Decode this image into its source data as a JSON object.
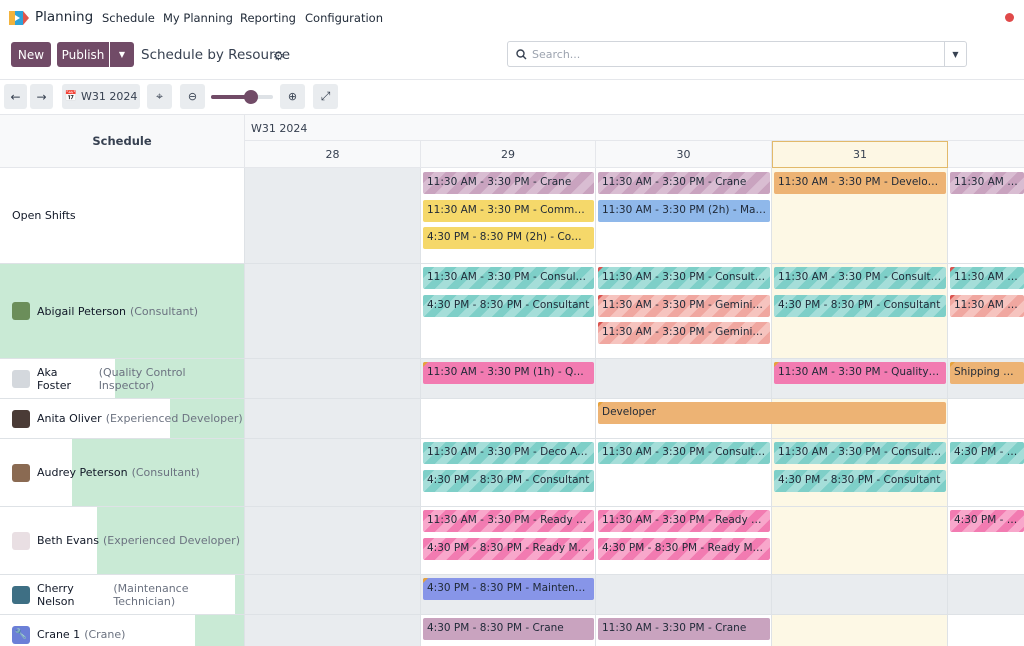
{
  "nav": {
    "app_title": "Planning",
    "menus": [
      "Schedule",
      "My Planning",
      "Reporting",
      "Configuration"
    ]
  },
  "control": {
    "new_label": "New",
    "publish_label": "Publish",
    "page_title": "Schedule by Resource",
    "search_placeholder": "Search..."
  },
  "toolbar": {
    "week_label": "W31 2024",
    "zoom_level": 0.65
  },
  "grid": {
    "left_header": "Schedule",
    "week_header": "W31 2024",
    "days": [
      "28",
      "29",
      "30",
      "31"
    ],
    "rows": [
      {
        "name": "Open Shifts",
        "role": ""
      },
      {
        "name": "Abigail Peterson",
        "role": "(Consultant)"
      },
      {
        "name": "Aka Foster",
        "role": "(Quality Control Inspector)"
      },
      {
        "name": "Anita Oliver",
        "role": "(Experienced Developer)"
      },
      {
        "name": "Audrey Peterson",
        "role": "(Consultant)"
      },
      {
        "name": "Beth Evans",
        "role": "(Experienced Developer)"
      },
      {
        "name": "Cherry Nelson",
        "role": "(Maintenance Technician)"
      },
      {
        "name": "Crane 1",
        "role": "(Crane)"
      }
    ]
  },
  "shifts": [
    "11:30 AM - 3:30 PM - Crane",
    "11:30 AM - 3:30 PM - Crane",
    "11:30 AM - 3:30 PM - Developer ...",
    "11:30 AM - 3:30",
    "11:30 AM - 3:30 PM - Communit...",
    "11:30 AM - 3:30 PM (2h) - Mana...",
    "4:30 PM - 8:30 PM (2h) - Commu...",
    "11:30 AM - 3:30 PM - Consultant",
    "11:30 AM - 3:30 PM - Consultant",
    "11:30 AM - 3:30 PM - Consultant",
    "11:30 AM - 3:30",
    "4:30 PM - 8:30 PM - Consultant",
    "11:30 AM - 3:30 PM - Gemini Fur...",
    "4:30 PM - 8:30 PM - Consultant",
    "11:30 AM - 3:30",
    "11:30 AM - 3:30 PM - Gemini Fur...",
    "11:30 AM - 3:30 PM (1h) - Qualit...",
    "11:30 AM - 3:30 PM - Quality Co...",
    "Shipping Assoc",
    "Developer",
    "11:30 AM - 3:30 PM - Deco Addi...",
    "11:30 AM - 3:30 PM - Consultant",
    "11:30 AM - 3:30 PM - Consultant",
    "4:30 PM - 8:30",
    "4:30 PM - 8:30 PM - Consultant",
    "4:30 PM - 8:30 PM - Consultant",
    "11:30 AM - 3:30 PM - Ready Mat...",
    "11:30 AM - 3:30 PM - Ready Mat...",
    "4:30 PM - 8:30",
    "4:30 PM - 8:30 PM - Ready Mat -...",
    "4:30 PM - 8:30 PM - Ready Mat -...",
    "4:30 PM - 8:30 PM - Maintenanc...",
    "4:30 PM - 8:30 PM - Crane",
    "11:30 AM - 3:30 PM - Crane"
  ]
}
